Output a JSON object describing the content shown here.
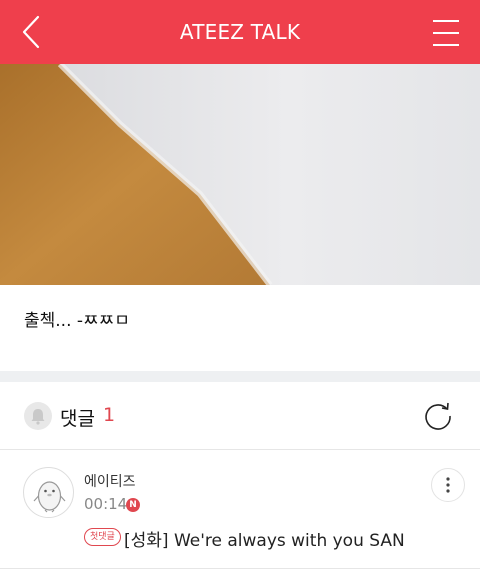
{
  "header": {
    "title": "ATEEZ TALK",
    "bg_color": "#ef3f4c",
    "back_icon": "chevron-left-icon",
    "menu_icon": "hamburger-menu-icon"
  },
  "post": {
    "text": "출첵... -ㅉㅉㅁ"
  },
  "comments": {
    "label": "댓글",
    "count": "1",
    "bell_icon": "bell-icon",
    "refresh_icon": "refresh-icon",
    "items": [
      {
        "author": "에이티즈",
        "time": "00:14",
        "new_badge": "N",
        "tag": "첫댓글",
        "text": "[성화] We're always with you SAN",
        "more_icon": "more-vertical-icon"
      }
    ]
  }
}
